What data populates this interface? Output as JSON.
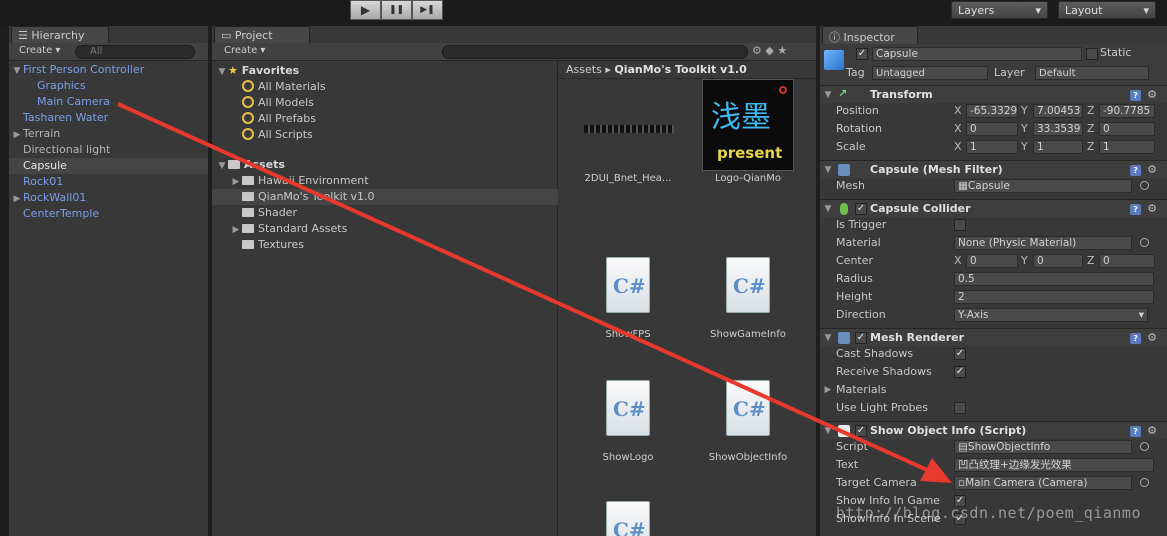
{
  "toolbar": {
    "play_glyph": "▶",
    "pause_glyph": "❚❚",
    "step_glyph": "▶❚",
    "layers_label": "Layers",
    "layout_label": "Layout"
  },
  "hierarchy": {
    "tab_label": "Hierarchy",
    "create_label": "Create",
    "search_placeholder": "All",
    "items": [
      {
        "label": "First Person Controller",
        "blue": true,
        "indent": 0,
        "fold": "▼"
      },
      {
        "label": "Graphics",
        "blue": true,
        "indent": 1,
        "fold": ""
      },
      {
        "label": "Main Camera",
        "blue": true,
        "indent": 1,
        "fold": ""
      },
      {
        "label": "Tasharen Water",
        "blue": true,
        "indent": 0,
        "fold": ""
      },
      {
        "label": "Terrain",
        "blue": false,
        "indent": 0,
        "fold": "▶"
      },
      {
        "label": "Directional light",
        "blue": false,
        "indent": 0,
        "fold": ""
      },
      {
        "label": "Capsule",
        "blue": false,
        "indent": 0,
        "fold": "",
        "selected": true
      },
      {
        "label": "Rock01",
        "blue": true,
        "indent": 0,
        "fold": ""
      },
      {
        "label": "RockWall01",
        "blue": true,
        "indent": 0,
        "fold": "▶"
      },
      {
        "label": "CenterTemple",
        "blue": true,
        "indent": 0,
        "fold": ""
      }
    ]
  },
  "project": {
    "tab_label": "Project",
    "create_label": "Create",
    "favorites_label": "Favorites",
    "favorites": [
      "All Materials",
      "All Models",
      "All Prefabs",
      "All Scripts"
    ],
    "assets_label": "Assets",
    "folders": [
      {
        "label": "Hawaii Environment",
        "fold": "▶"
      },
      {
        "label": "QianMo's Toolkit v1.0",
        "fold": "",
        "selected": true
      },
      {
        "label": "Shader",
        "fold": ""
      },
      {
        "label": "Standard Assets",
        "fold": "▶"
      },
      {
        "label": "Textures",
        "fold": ""
      }
    ],
    "breadcrumb": {
      "root": "Assets",
      "sep": "▸",
      "current": "QianMo's Toolkit v1.0"
    },
    "assets": [
      "2DUI_Bnet_Hea...",
      "Logo-QianMo",
      "ShowFPS",
      "ShowGameInfo",
      "ShowLogo",
      "ShowObjectInfo"
    ],
    "logo_text": {
      "top": "浅墨",
      "bottom": "present"
    }
  },
  "inspector": {
    "tab_label": "Inspector",
    "object_name": "Capsule",
    "static_label": "Static",
    "tag_label": "Tag",
    "tag_value": "Untagged",
    "layer_label": "Layer",
    "layer_value": "Default",
    "transform": {
      "title": "Transform",
      "position": {
        "label": "Position",
        "x": "-65.3329",
        "y": "7.00453",
        "z": "-90.7785"
      },
      "rotation": {
        "label": "Rotation",
        "x": "0",
        "y": "33.3539",
        "z": "0"
      },
      "scale": {
        "label": "Scale",
        "x": "1",
        "y": "1",
        "z": "1"
      }
    },
    "mesh_filter": {
      "title": "Capsule (Mesh Filter)",
      "mesh_label": "Mesh",
      "mesh_value": "Capsule"
    },
    "collider": {
      "title": "Capsule Collider",
      "is_trigger": "Is Trigger",
      "material_label": "Material",
      "material_value": "None (Physic Material)",
      "center_label": "Center",
      "cx": "0",
      "cy": "0",
      "cz": "0",
      "radius_label": "Radius",
      "radius_value": "0.5",
      "height_label": "Height",
      "height_value": "2",
      "direction_label": "Direction",
      "direction_value": "Y-Axis"
    },
    "renderer": {
      "title": "Mesh Renderer",
      "cast_shadows": "Cast Shadows",
      "receive_shadows": "Receive Shadows",
      "materials": "Materials",
      "use_light_probes": "Use Light Probes"
    },
    "script": {
      "title": "Show Object Info (Script)",
      "script_label": "Script",
      "script_value": "ShowObjectInfo",
      "text_label": "Text",
      "text_value": "凹凸纹理+边缘发光效果",
      "target_label": "Target Camera",
      "target_value": "Main Camera (Camera)",
      "show_game_label": "Show Info In Game",
      "show_scene_label": "Show Info In Scene"
    },
    "axis_x": "X",
    "axis_y": "Y",
    "axis_z": "Z"
  },
  "watermark": "http://blog.csdn.net/poem_qianmo",
  "colors": {
    "annotation_arrow": "#e8392f",
    "blue_prefab": "#7b9fe6"
  }
}
